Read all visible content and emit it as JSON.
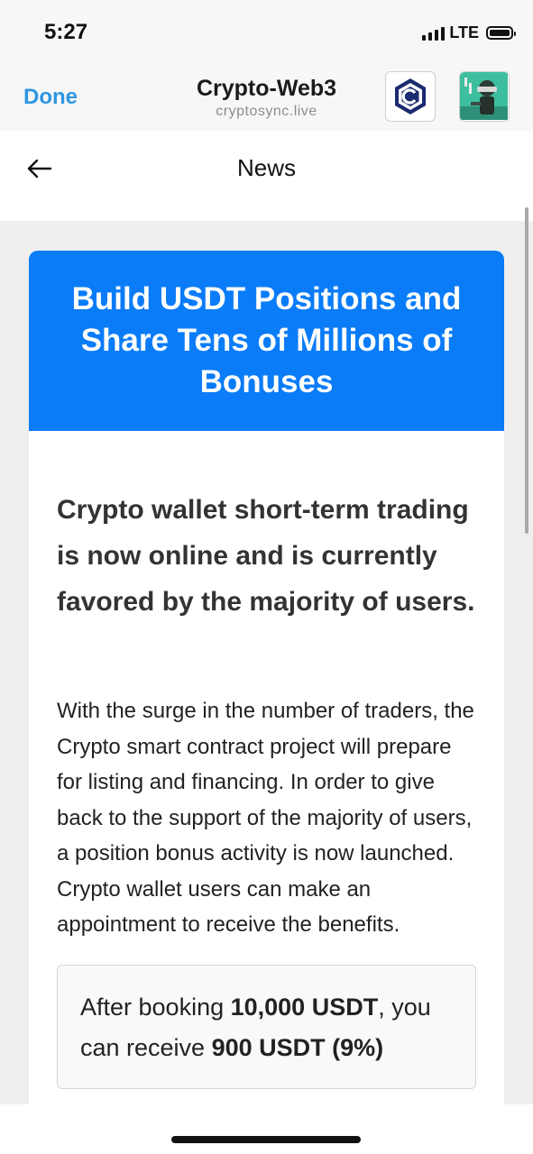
{
  "status_bar": {
    "time": "5:27",
    "network": "LTE"
  },
  "browser": {
    "done_label": "Done",
    "site_title": "Crypto-Web3",
    "site_url": "cryptosync.live"
  },
  "nav": {
    "title": "News"
  },
  "article": {
    "header_title": "Build USDT Positions and Share Tens of Millions of Bonuses",
    "lead": "Crypto wallet short-term trading is now online and is currently favored by the majority of users.",
    "body": "With the surge in the number of traders, the Crypto smart contract project will prepare for listing and financing. In order to give back to the support of the majority of users, a position bonus activity is now launched. Crypto wallet users can make an appointment to receive the benefits.",
    "bonus": {
      "prefix": "After booking ",
      "amount": "10,000 USDT",
      "middle": ", you can receive ",
      "reward": "900 USDT (9%)"
    }
  },
  "colors": {
    "accent": "#0a7cf8",
    "done": "#2f96e2"
  },
  "icons": [
    "signal-icon",
    "battery-icon",
    "cronos-logo-icon",
    "avatar-icon",
    "back-arrow-icon"
  ]
}
